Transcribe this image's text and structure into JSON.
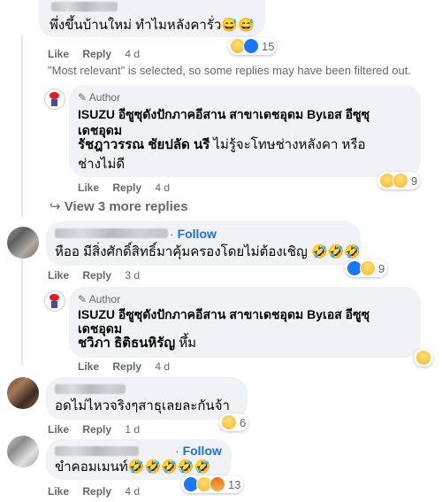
{
  "actions": {
    "like": "Like",
    "reply": "Reply"
  },
  "comments": [
    {
      "text": "พึ่งขึ้นบ้านใหม่ ทำไมหลังคารั่ว😅😅",
      "time": "4 d",
      "reaction_count": "15",
      "reactions": [
        "haha",
        "like"
      ]
    },
    {
      "text": "หืออ มีสิ่งศักดิ์สิทธิ์มาคุ้มครองโดยไม่ต้องเชิญ 🤣🤣🤣",
      "time": "3 d",
      "reaction_count": "9",
      "follow_label": "Follow",
      "reactions": [
        "like",
        "haha"
      ]
    },
    {
      "text": "อดไม่ไหวจริงๆสาธุเลยละกันจ้า",
      "time": "1 d",
      "reaction_count": "6",
      "reactions": [
        "haha"
      ]
    },
    {
      "text": "ขำคอมเมนท์🤣🤣🤣🤣🤣",
      "time": "4 d",
      "reaction_count": "13",
      "follow_label": "Follow",
      "reactions": [
        "like",
        "haha",
        "angry"
      ]
    }
  ],
  "notice": "\"Most relevant\" is selected, so some replies may have been filtered out.",
  "replies": [
    {
      "author_tag": "Author",
      "page_name_line1": "ISUZU อีซูซุดังปักภาคอีสาน สาขาเดชอุดม Byเอส อีซูซุ",
      "page_name_line2": "เดชอุดม",
      "mention": "รัชฎาวรรณ ชัยปลัด นรี",
      "text_line1": " ไม่รู้จะโทษช่างหลังคา หรือ",
      "text_line2": "ช่างไม่ดี",
      "time": "4 d",
      "reaction_count": "9",
      "reactions": [
        "haha",
        "sad"
      ]
    },
    {
      "author_tag": "Author",
      "page_name_line1": "ISUZU อีซูซุดังปักภาคอีสาน สาขาเดชอุดม Byเอส อีซูซุ",
      "page_name_line2": "เดชอุดม",
      "mention": "ชวิภา ธิติธนหิรัญ",
      "text_line1": " หึ้ม",
      "time": "4 d",
      "reactions": [
        "haha"
      ]
    }
  ],
  "view_more_replies": "View 3 more replies"
}
